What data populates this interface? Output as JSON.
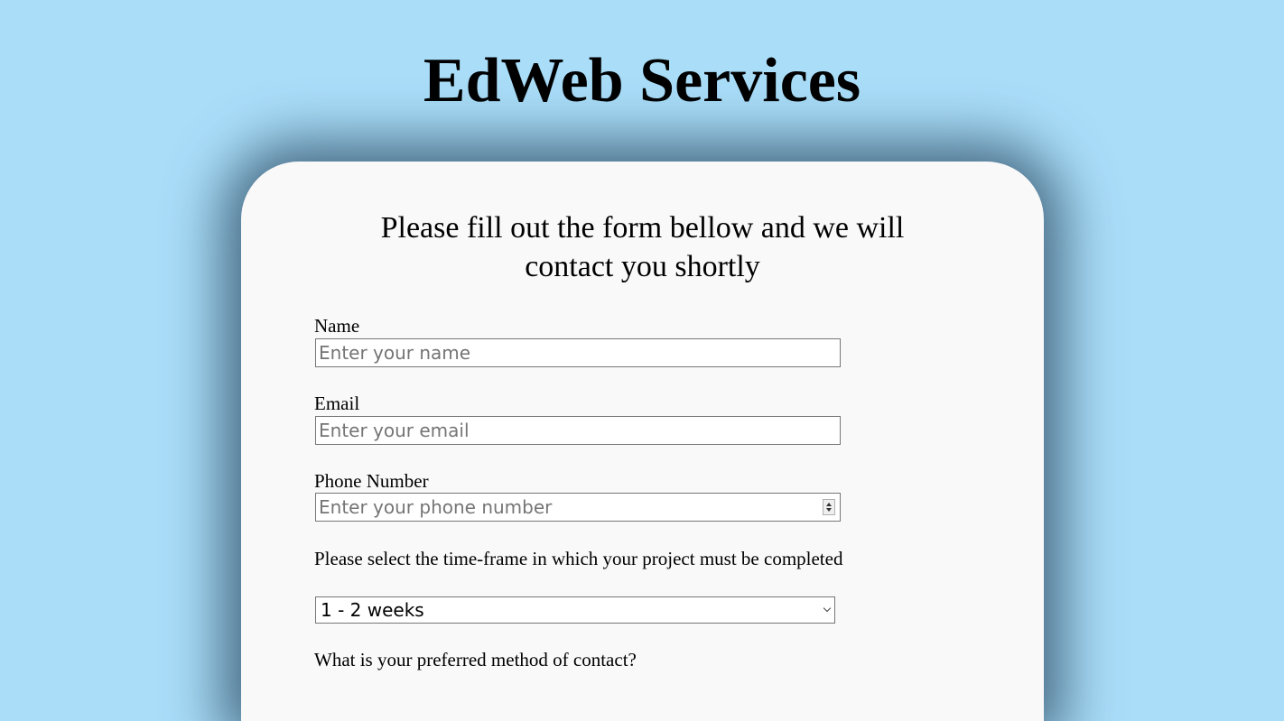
{
  "header": {
    "title": "EdWeb Services"
  },
  "form": {
    "intro": "Please fill out the form bellow and we will contact you shortly",
    "name": {
      "label": "Name",
      "placeholder": "Enter your name"
    },
    "email": {
      "label": "Email",
      "placeholder": "Enter your email"
    },
    "phone": {
      "label": "Phone Number",
      "placeholder": "Enter your phone number",
      "spinner_icon": "spin-arrows-icon"
    },
    "timeframe": {
      "question": "Please select the time-frame in which your project must be completed",
      "selected": "1 - 2 weeks",
      "dropdown_icon": "chevron-down-icon"
    },
    "contact_method": {
      "question": "What is your preferred method of contact?"
    }
  },
  "colors": {
    "page_background": "#a9ddf8",
    "card_background": "#f9f9f9",
    "input_border": "#767676"
  }
}
